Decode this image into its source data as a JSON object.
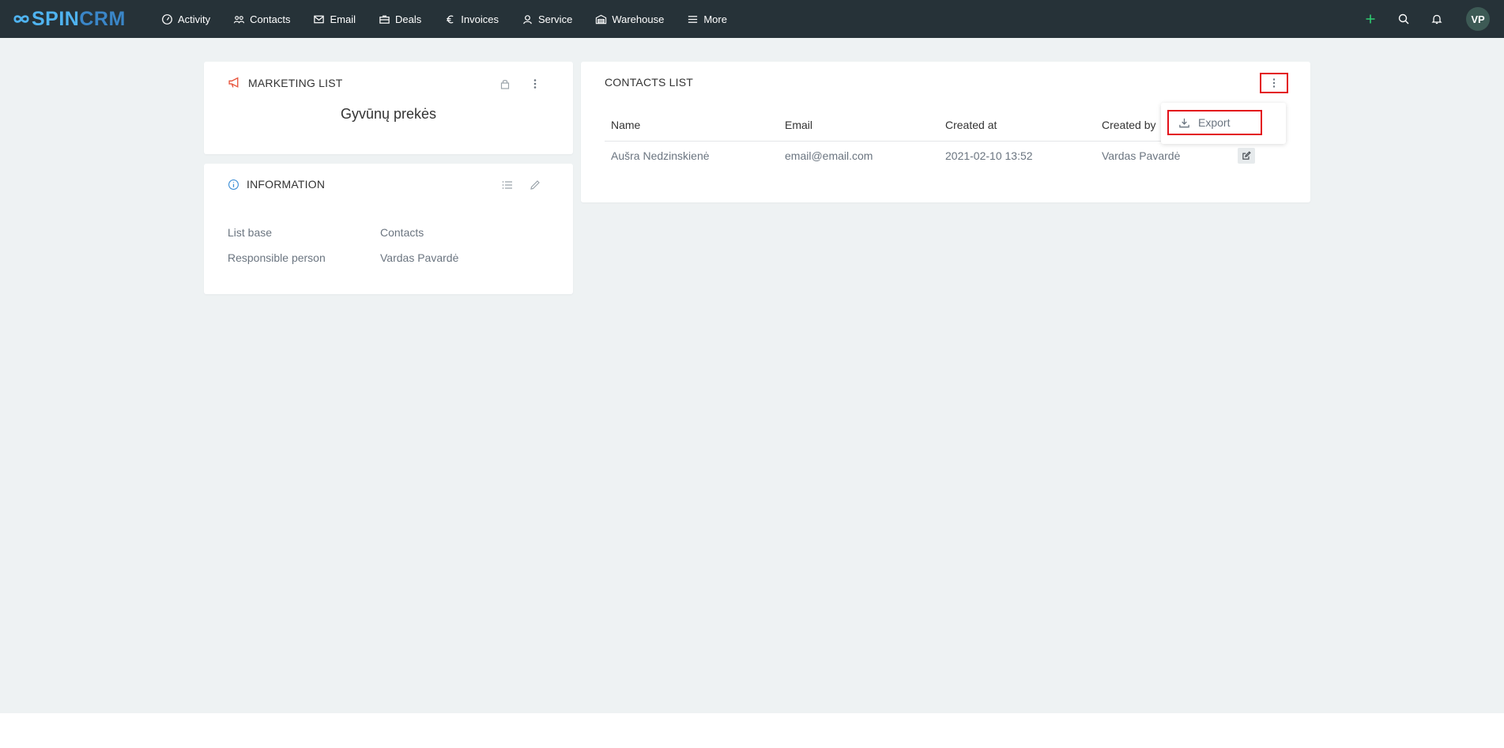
{
  "brand": {
    "spin": "SPIN",
    "crm": "CRM"
  },
  "nav": [
    {
      "label": "Activity",
      "icon": "activity-gauge-icon"
    },
    {
      "label": "Contacts",
      "icon": "contacts-people-icon"
    },
    {
      "label": "Email",
      "icon": "envelope-icon"
    },
    {
      "label": "Deals",
      "icon": "briefcase-icon"
    },
    {
      "label": "Invoices",
      "icon": "euro-icon"
    },
    {
      "label": "Service",
      "icon": "user-service-icon"
    },
    {
      "label": "Warehouse",
      "icon": "warehouse-icon"
    },
    {
      "label": "More",
      "icon": "menu-lines-icon"
    }
  ],
  "user": {
    "initials": "VP"
  },
  "colors": {
    "topbar": "#263238",
    "accent_green": "#2ecc71",
    "highlight_red": "#e3101a",
    "megaphone": "#e8573f",
    "info_blue": "#3d8fd6"
  },
  "marketing_card": {
    "title": "MARKETING LIST",
    "list_name": "Gyvūnų prekės"
  },
  "information_card": {
    "title": "INFORMATION",
    "rows": [
      {
        "label": "List base",
        "value": "Contacts"
      },
      {
        "label": "Responsible person",
        "value": "Vardas Pavardė"
      }
    ]
  },
  "contacts_card": {
    "title": "CONTACTS LIST",
    "columns": [
      "Name",
      "Email",
      "Created at",
      "Created by"
    ],
    "rows": [
      {
        "name": "Aušra Nedzinskienė",
        "email": "email@email.com",
        "created_at": "2021-02-10 13:52",
        "created_by": "Vardas Pavardė"
      }
    ],
    "menu": {
      "export_label": "Export"
    }
  }
}
